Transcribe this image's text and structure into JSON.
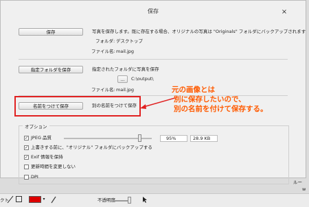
{
  "dialog": {
    "title": "保存",
    "close_icon": "×"
  },
  "save": {
    "button": "保存",
    "description": "写真を保存します。既に存在する場合、オリジナルの写真は \"Originals\" フォルダにバックアップされます",
    "folder_label": "フォルダ:",
    "folder_value": "デスクトップ",
    "filename_label": "ファイル名:",
    "filename_value": "mail.jpg"
  },
  "save_to_folder": {
    "button": "指定フォルダを保存",
    "description": "指定されたフォルダに写真を保存",
    "browse": "...",
    "path": "C:\\output\\",
    "filename_label": "ファイル名:",
    "filename_value": "mail.jpg"
  },
  "save_as": {
    "button": "名前をつけて保存",
    "description": "別の名前をつけて保存"
  },
  "annotation": {
    "line1": "元の画像とは",
    "line2": "別に保存したいので、",
    "line3": "別の名前を付けて保存する。",
    "color": "#ff5a00"
  },
  "options": {
    "legend": "オプション",
    "jpeg_label": "JPEG 品質",
    "jpeg_quality": "95%",
    "jpeg_size": "28.9 KB",
    "backup_label": "上書きする前に、\"オリジナル\" フォルダにバックアップする",
    "exif_label": "Exif 情報を保持",
    "keep_time_label": "更新時間を変更しない",
    "dpi_label": "DPI"
  },
  "bottombar": {
    "left_text": "クト",
    "opacity_label": "不透明度",
    "zoom_text": "ルー",
    "right_text": "w"
  },
  "colors": {
    "highlight": "#e02020",
    "swatch": "#dd0000"
  }
}
